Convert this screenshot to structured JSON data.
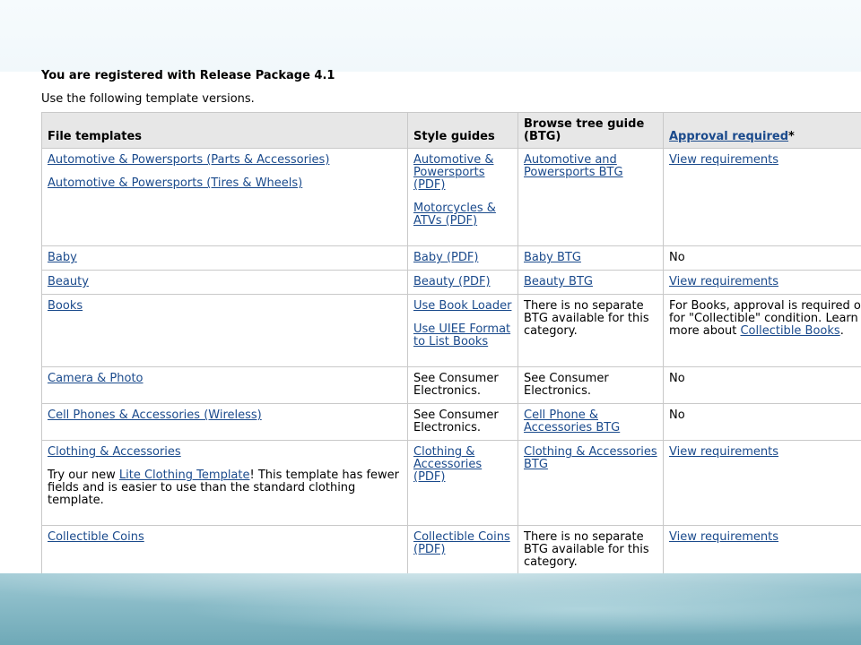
{
  "heading": "You are registered with Release Package 4.1",
  "intro": "Use the following template versions.",
  "columns": {
    "file_templates": "File templates",
    "style_guides": "Style guides",
    "btg": "Browse tree guide (BTG)",
    "approval_link": "Approval required",
    "approval_suffix": "*"
  },
  "rows": [
    {
      "files": [
        "Automotive & Powersports (Parts & Accessories)",
        "Automotive & Powersports (Tires & Wheels)"
      ],
      "styles": [
        "Automotive & Powersports (PDF)",
        "Motorcycles & ATVs (PDF)"
      ],
      "btg": "Automotive and Powersports BTG",
      "approval": "View requirements"
    },
    {
      "files": [
        "Baby"
      ],
      "styles": [
        "Baby (PDF)"
      ],
      "btg": "Baby BTG",
      "approval": "No"
    },
    {
      "files": [
        "Beauty"
      ],
      "styles": [
        "Beauty (PDF)"
      ],
      "btg": "Beauty BTG",
      "approval": "View requirements"
    },
    {
      "files": [
        "Books"
      ],
      "styles": [
        "Use Book Loader",
        "Use UIEE Format to List Books"
      ],
      "btg": "There is no separate BTG available for this category.",
      "approval_pre": "For Books, approval is required only for \"Collectible\" condition. Learn more about ",
      "approval_link": "Collectible Books",
      "approval_post": "."
    },
    {
      "files": [
        "Camera & Photo"
      ],
      "styles": [
        "See Consumer Electronics."
      ],
      "btg": "See Consumer Electronics.",
      "approval": "No"
    },
    {
      "files": [
        "Cell Phones & Accessories (Wireless)"
      ],
      "styles": [
        "See Consumer Electronics."
      ],
      "btg": "Cell Phone & Accessories BTG",
      "approval": "No"
    },
    {
      "files": [
        "Clothing & Accessories"
      ],
      "note_pre": "Try our new ",
      "note_link": "Lite Clothing Template",
      "note_post": "! This template has fewer fields and is easier to use than the standard clothing template.",
      "styles": [
        "Clothing & Accessories (PDF)"
      ],
      "btg": "Clothing & Accessories BTG",
      "approval": "View requirements"
    },
    {
      "files": [
        "Collectible Coins"
      ],
      "styles": [
        "Collectible Coins (PDF)"
      ],
      "btg": "There is no separate BTG available for this category.",
      "approval": "View requirements"
    }
  ]
}
